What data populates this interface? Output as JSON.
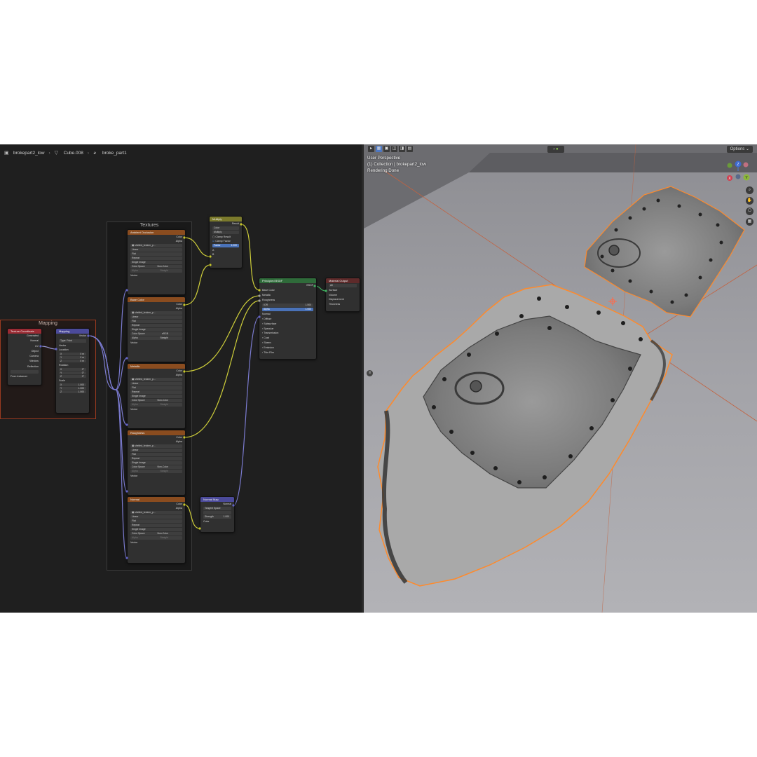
{
  "breadcrumb": {
    "object": "brokepart2_low",
    "mesh": "Cube.008",
    "material": "broke_part1"
  },
  "frames": {
    "textures": "Textures",
    "mapping": "Mapping"
  },
  "nodes": {
    "texcoord": {
      "title": "Texture Coordinate",
      "outputs": [
        "Generated",
        "Normal",
        "UV",
        "Object",
        "Camera",
        "Window",
        "Reflection"
      ],
      "option": "From Instancer"
    },
    "mapping": {
      "title": "Mapping",
      "output": "Vector",
      "type_label": "Type:",
      "type_value": "Point",
      "vector": "Vector",
      "location": "Location",
      "rotation": "Rotation",
      "scale": "Scale",
      "axes": [
        "X",
        "Y",
        "Z"
      ],
      "location_values": [
        "0 m",
        "0 m",
        "0 m"
      ],
      "rotation_values": [
        "0°",
        "0°",
        "0°"
      ],
      "scale_values": [
        "1.000",
        "1.000",
        "1.000"
      ]
    },
    "textures": [
      {
        "title": "Ambient Occlusion",
        "file": "shelled_broken_p...",
        "color_space": "Non-Color",
        "alpha": "Straight"
      },
      {
        "title": "Base Color",
        "file": "shelled_broken_p...",
        "color_space": "sRGB",
        "alpha": "Straight"
      },
      {
        "title": "Metallic",
        "file": "shelled_broken_p...",
        "color_space": "Non-Color",
        "alpha": "Straight"
      },
      {
        "title": "Roughness",
        "file": "shelled_broken_p...",
        "color_space": "Non-Color",
        "alpha": "Straight"
      },
      {
        "title": "Normal",
        "file": "shelled_broken_p...",
        "color_space": "Non-Color",
        "alpha": "Straight"
      }
    ],
    "texture_common": {
      "out_color": "Color",
      "out_alpha": "Alpha",
      "interp": "Linear",
      "projection": "Flat",
      "extension": "Repeat",
      "source": "Single Image",
      "color_space_label": "Color Space",
      "alpha_label": "Alpha",
      "vector": "Vector"
    },
    "multiply": {
      "title": "Multiply",
      "result": "Result",
      "type": "Color",
      "blend": "Multiply",
      "clamp_result": "Clamp Result",
      "clamp_factor": "Clamp Factor",
      "factor_label": "Factor",
      "factor_value": "1.000",
      "a": "A",
      "b": "B"
    },
    "bsdf": {
      "title": "Principled BSDF",
      "output": "BSDF",
      "inputs": [
        "Base Color",
        "Metallic",
        "Roughness"
      ],
      "ior_label": "IOR",
      "ior_value": "1.500",
      "alpha_label": "Alpha",
      "alpha_value": "1.000",
      "normal": "Normal",
      "panels": [
        "Diffuse",
        "Subsurface",
        "Specular",
        "Transmission",
        "Coat",
        "Sheen",
        "Emission",
        "Thin Film"
      ]
    },
    "output": {
      "title": "Material Output",
      "target": "All",
      "inputs": [
        "Surface",
        "Volume",
        "Displacement",
        "Thickness"
      ]
    },
    "normalmap": {
      "title": "Normal Map",
      "output": "Normal",
      "space": "Tangent Space",
      "strength_label": "Strength",
      "strength_value": "1.000",
      "color": "Color"
    }
  },
  "viewport": {
    "line1": "User Perspective",
    "line2": "(1) Collection | brokepart2_low",
    "line3": "Rendering Done",
    "options": "Options",
    "gizmo_labels": {
      "z": "Z",
      "y": "Y",
      "x": "X"
    }
  },
  "colors": {
    "texture_header": "#8a4c1f",
    "shader_header": "#2f6b3a",
    "vector_header": "#4b4a9a",
    "socket_yellow": "#c7c729",
    "socket_purple": "#6363c7",
    "socket_gray": "#a1a1a1",
    "selection_orange": "#ff8a2b"
  }
}
